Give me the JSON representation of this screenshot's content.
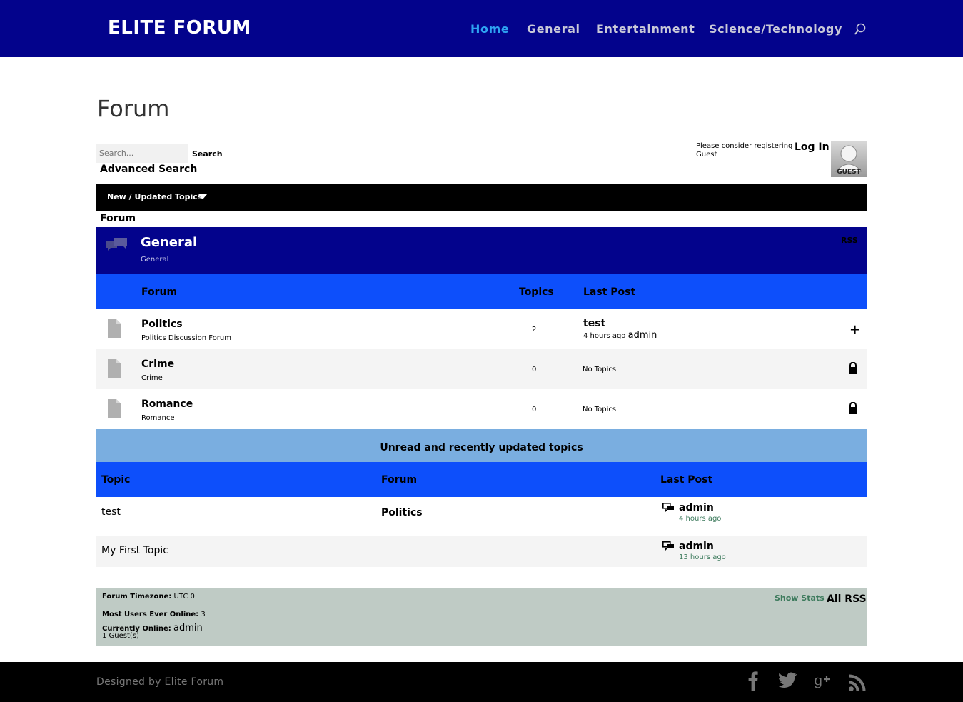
{
  "header": {
    "logo": "ELITE FORUM",
    "nav": [
      "Home",
      "General",
      "Entertainment",
      "Science/Technology"
    ],
    "active": "Home"
  },
  "page": {
    "title": "Forum"
  },
  "search": {
    "placeholder": "Search...",
    "button": "Search",
    "advanced": "Advanced Search"
  },
  "user": {
    "register_text": "Please consider registering",
    "guest_name": "Guest",
    "login": "Log In",
    "avatar_label": "GUEST"
  },
  "toolbar": {
    "new_topics": "New / Updated Topics"
  },
  "breadcrumb": "Forum",
  "category": {
    "title": "General",
    "description": "General",
    "rss": "RSS",
    "columns": {
      "forum": "Forum",
      "topics": "Topics",
      "last_post": "Last Post"
    },
    "forums": [
      {
        "name": "Politics",
        "description": "Politics Discussion Forum",
        "topics": "2",
        "last_post_title": "test",
        "last_post_time": "4 hours ago",
        "last_post_user": "admin",
        "action": "+"
      },
      {
        "name": "Crime",
        "description": "Crime",
        "topics": "0",
        "last_post": "No Topics",
        "action": "lock"
      },
      {
        "name": "Romance",
        "description": "Romance",
        "topics": "0",
        "last_post": "No Topics",
        "action": "lock"
      }
    ]
  },
  "recent": {
    "heading": "Unread and recently updated topics",
    "columns": {
      "topic": "Topic",
      "forum": "Forum",
      "last_post": "Last Post"
    },
    "topics": [
      {
        "title": "test",
        "forum": "Politics",
        "user": "admin",
        "time": "4 hours ago"
      },
      {
        "title": "My First Topic",
        "forum": "",
        "user": "admin",
        "time": "13 hours ago"
      }
    ]
  },
  "stats": {
    "timezone_label": "Forum Timezone:",
    "timezone_value": "UTC 0",
    "most_users_label": "Most Users Ever Online:",
    "most_users_value": "3",
    "current_label": "Currently Online:",
    "current_value": "admin",
    "guests": "1 Guest(s)",
    "show_stats": "Show Stats",
    "all_rss": "All RSS"
  },
  "footer": {
    "text": "Designed by Elite Forum",
    "social": [
      "facebook-icon",
      "twitter-icon",
      "google-plus-icon",
      "rss-icon"
    ]
  },
  "colors": {
    "nav_bg": "#03038c",
    "accent_blue": "#0d4ffb",
    "light_blue": "#7aaee0",
    "stats_bg": "#bfcbc5",
    "link_active": "#2ea3f2"
  }
}
